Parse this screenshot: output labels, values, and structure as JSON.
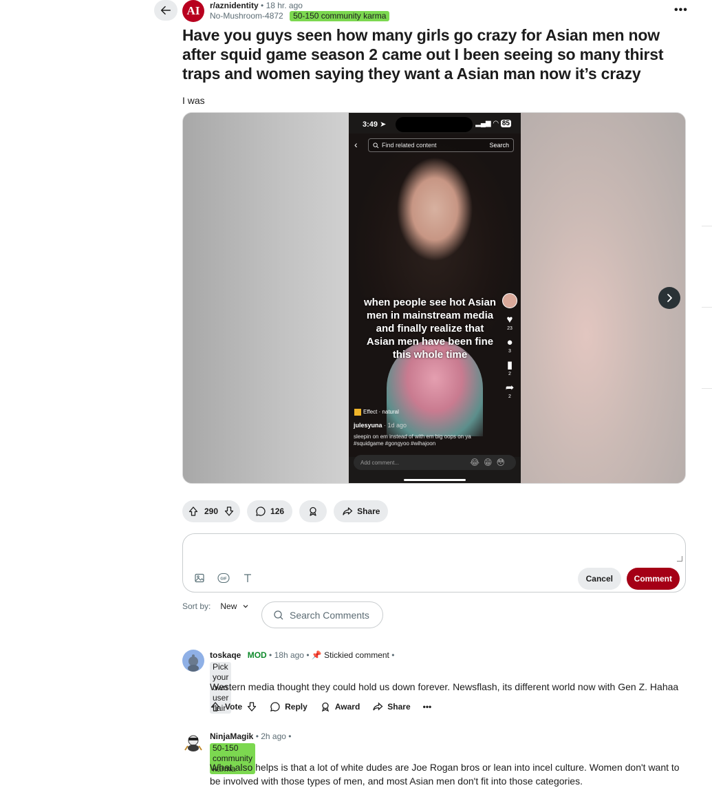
{
  "post": {
    "subreddit": "r/aznidentity",
    "subreddit_icon_text": "AI",
    "time": "18 hr. ago",
    "author": "No-Mushroom-4872",
    "author_flair": "50-150 community karma",
    "title": "Have you guys seen how many girls go crazy for Asian men now after squid game season 2 came out I been seeing so many thirst traps and women saying they want a Asian man now it’s crazy",
    "body": "I was"
  },
  "media": {
    "status_time": "3:49",
    "battery": "85",
    "search_placeholder": "Find related content",
    "search_button": "Search",
    "overlay_text": "when people see hot Asian men in mainstream media and finally realize that Asian men have been fine this whole time",
    "likes": "23",
    "comments": "3",
    "saves": "2",
    "shares": "2",
    "effect": "Effect · natural",
    "username": "julesyuna",
    "user_ago": "· 1d ago",
    "caption": "sleepin on em instead of with em big oops on ya #squidgame #gongyoo #wihajoon",
    "add_comment": "Add comment..."
  },
  "actions": {
    "votes": "290",
    "comments": "126",
    "share": "Share"
  },
  "comment_box": {
    "cancel": "Cancel",
    "submit": "Comment"
  },
  "sort": {
    "label": "Sort by:",
    "value": "New",
    "search_placeholder": "Search Comments"
  },
  "comments": [
    {
      "author": "toskaqe",
      "badge": "MOD",
      "time": "18h ago",
      "sticky": "Stickied comment",
      "flair": "Pick your own user flair",
      "body": "Western media thought they could hold us down forever. Newsflash, its different world now with Gen Z. Hahaa",
      "vote": "Vote",
      "reply": "Reply",
      "award": "Award",
      "share": "Share"
    },
    {
      "author": "NinjaMagik",
      "time": "2h ago",
      "flair": "50-150 community karma",
      "body": "What also helps is that a lot of white dudes are Joe Rogan bros or lean into incel culture. Women don't want to be involved with those types of men, and most Asian men don't fit into those categories."
    }
  ],
  "colors": {
    "flair_green": "#7cd850",
    "comment_button": "#a50016",
    "subreddit_icon": "#b8001f",
    "mod_green": "#0f8a2c"
  }
}
